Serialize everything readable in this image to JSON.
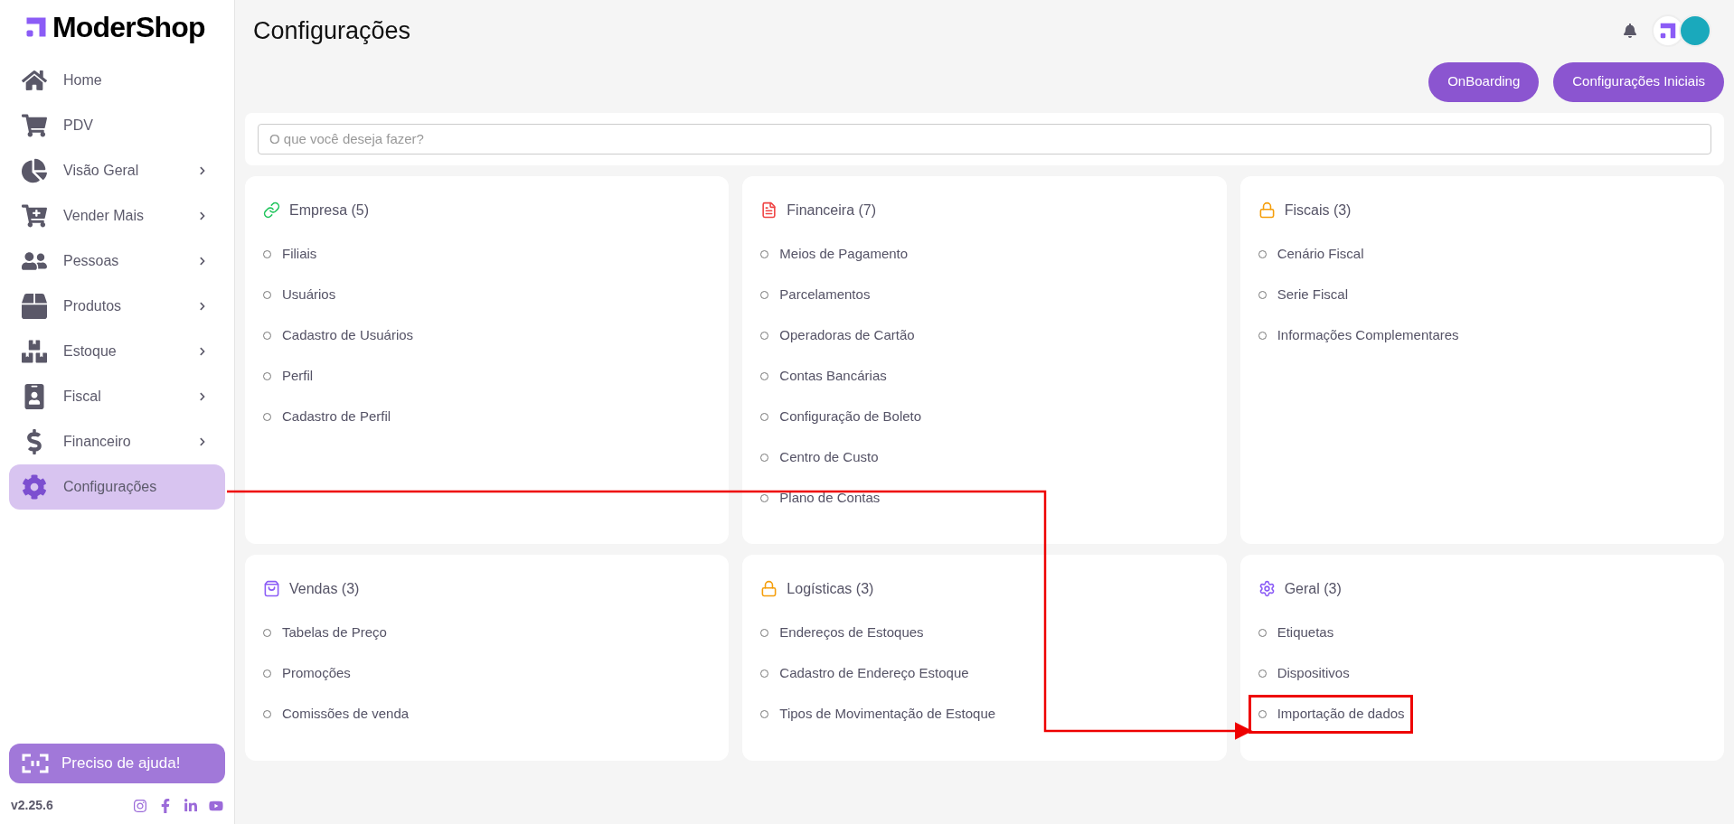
{
  "brand": {
    "name": "ModerShop"
  },
  "sidebar": {
    "items": [
      {
        "label": "Home",
        "expandable": false,
        "selected": false
      },
      {
        "label": "PDV",
        "expandable": false,
        "selected": false
      },
      {
        "label": "Visão Geral",
        "expandable": true,
        "selected": false
      },
      {
        "label": "Vender Mais",
        "expandable": true,
        "selected": false
      },
      {
        "label": "Pessoas",
        "expandable": true,
        "selected": false
      },
      {
        "label": "Produtos",
        "expandable": true,
        "selected": false
      },
      {
        "label": "Estoque",
        "expandable": true,
        "selected": false
      },
      {
        "label": "Fiscal",
        "expandable": true,
        "selected": false
      },
      {
        "label": "Financeiro",
        "expandable": true,
        "selected": false
      },
      {
        "label": "Configurações",
        "expandable": false,
        "selected": true
      }
    ],
    "help_button": "Preciso de ajuda!",
    "version": "v2.25.6"
  },
  "header": {
    "title": "Configurações",
    "buttons": [
      "OnBoarding",
      "Configurações Iniciais"
    ]
  },
  "search": {
    "placeholder": "O que você deseja fazer?"
  },
  "cards": [
    {
      "title": "Empresa (5)",
      "color": "#22c55e",
      "items": [
        {
          "label": "Filiais",
          "highlighted": false
        },
        {
          "label": "Usuários",
          "highlighted": false
        },
        {
          "label": "Cadastro de Usuários",
          "highlighted": false
        },
        {
          "label": "Perfil",
          "highlighted": false
        },
        {
          "label": "Cadastro de Perfil",
          "highlighted": false
        }
      ]
    },
    {
      "title": "Financeira (7)",
      "color": "#ef4444",
      "items": [
        {
          "label": "Meios de Pagamento",
          "highlighted": false
        },
        {
          "label": "Parcelamentos",
          "highlighted": false
        },
        {
          "label": "Operadoras de Cartão",
          "highlighted": false
        },
        {
          "label": "Contas Bancárias",
          "highlighted": false
        },
        {
          "label": "Configuração de Boleto",
          "highlighted": false
        },
        {
          "label": "Centro de Custo",
          "highlighted": false
        },
        {
          "label": "Plano de Contas",
          "highlighted": false
        }
      ]
    },
    {
      "title": "Fiscais (3)",
      "color": "#f59e0b",
      "items": [
        {
          "label": "Cenário Fiscal",
          "highlighted": false
        },
        {
          "label": "Serie Fiscal",
          "highlighted": false
        },
        {
          "label": "Informações Complementares",
          "highlighted": false
        }
      ]
    },
    {
      "title": "Vendas (3)",
      "color": "#8b5cf6",
      "items": [
        {
          "label": "Tabelas de Preço",
          "highlighted": false
        },
        {
          "label": "Promoções",
          "highlighted": false
        },
        {
          "label": "Comissões de venda",
          "highlighted": false
        }
      ]
    },
    {
      "title": "Logísticas (3)",
      "color": "#f59e0b",
      "items": [
        {
          "label": "Endereços de Estoques",
          "highlighted": false
        },
        {
          "label": "Cadastro de Endereço Estoque",
          "highlighted": false
        },
        {
          "label": "Tipos de Movimentação de Estoque",
          "highlighted": false
        }
      ]
    },
    {
      "title": "Geral (3)",
      "color": "#8b5cf6",
      "items": [
        {
          "label": "Etiquetas",
          "highlighted": false
        },
        {
          "label": "Dispositivos",
          "highlighted": false
        },
        {
          "label": "Importação de dados",
          "highlighted": true
        }
      ]
    }
  ]
}
